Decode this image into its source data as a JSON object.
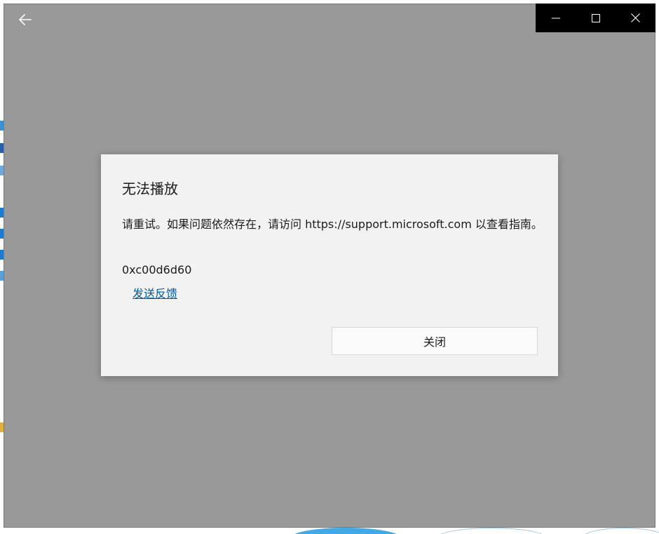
{
  "window": {
    "back_icon": "arrow-left-icon",
    "caption_icons": [
      "minimize-icon",
      "maximize-icon",
      "close-icon"
    ],
    "background_color": "#999999",
    "caption_color": "#000000"
  },
  "dialog": {
    "title": "无法播放",
    "message": "请重试。如果问题依然存在，请访问 https://support.microsoft.com 以查看指南。",
    "error_code": "0xc00d6d60",
    "feedback_link": "发送反馈",
    "close_button": "关闭",
    "link_color": "#005a9e",
    "background_color": "#f2f2f2"
  }
}
